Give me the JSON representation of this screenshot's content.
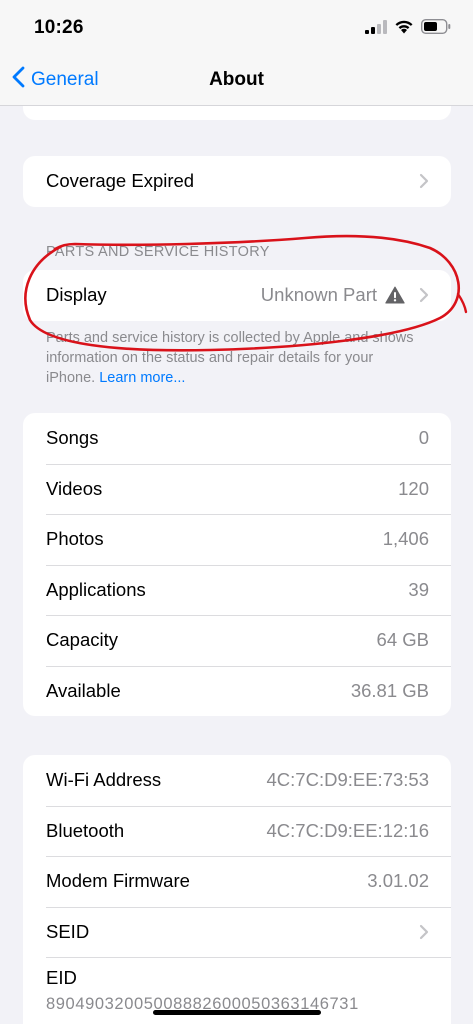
{
  "status_bar": {
    "time": "10:26"
  },
  "nav": {
    "back_label": "General",
    "title": "About"
  },
  "coverage": {
    "label": "Coverage Expired"
  },
  "parts_section": {
    "header": "PARTS AND SERVICE HISTORY",
    "display_label": "Display",
    "display_value": "Unknown Part",
    "footer_text": "Parts and service history is collected by Apple and shows information on the status and repair details for your iPhone. ",
    "learn_more": "Learn more..."
  },
  "media_group": [
    {
      "label": "Songs",
      "value": "0"
    },
    {
      "label": "Videos",
      "value": "120"
    },
    {
      "label": "Photos",
      "value": "1,406"
    },
    {
      "label": "Applications",
      "value": "39"
    },
    {
      "label": "Capacity",
      "value": "64 GB"
    },
    {
      "label": "Available",
      "value": "36.81 GB"
    }
  ],
  "network_group": [
    {
      "label": "Wi-Fi Address",
      "value": "4C:7C:D9:EE:73:53"
    },
    {
      "label": "Bluetooth",
      "value": "4C:7C:D9:EE:12:16"
    },
    {
      "label": "Modem Firmware",
      "value": "3.01.02"
    },
    {
      "label": "SEID",
      "value": ""
    }
  ],
  "eid": {
    "label": "EID",
    "value": "89049032005008882600050363146731"
  },
  "colors": {
    "accent": "#007aff",
    "annotation": "#d9121a",
    "secondary_text": "#8a8a8e",
    "background": "#f2f2f7"
  },
  "icons": {
    "back": "chevron-left-icon",
    "disclosure": "chevron-right-icon",
    "warning": "warning-triangle-icon",
    "signal": "cellular-signal-icon",
    "wifi": "wifi-icon",
    "battery": "battery-icon"
  }
}
